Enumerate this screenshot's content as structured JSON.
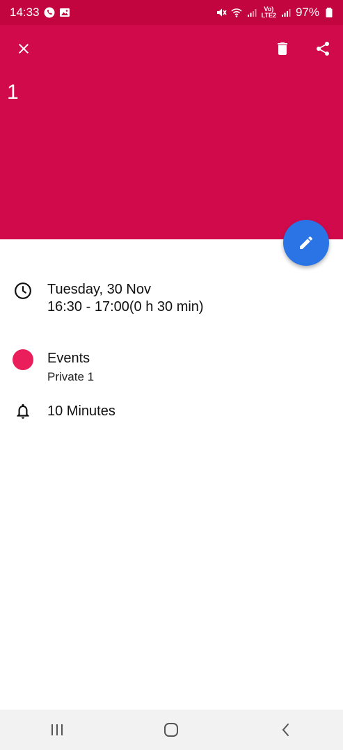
{
  "status_bar": {
    "time": "14:33",
    "battery": "97%",
    "network_label_top": "Vo)",
    "network_label_bottom": "LTE2"
  },
  "header": {
    "title": "1",
    "background_color": "#d10b4b",
    "icons": [
      "close-icon",
      "delete-icon",
      "share-icon"
    ]
  },
  "fab": {
    "icon": "edit-icon",
    "color": "#2a74e6"
  },
  "event": {
    "date": "Tuesday, 30 Nov",
    "time_range": "16:30 - 17:00(0 h 30 min)",
    "calendar_name": "Events",
    "calendar_account": "Private 1",
    "calendar_color": "#e91e5a",
    "reminder": "10 Minutes"
  },
  "nav_bar": {
    "icons": [
      "recent-apps-icon",
      "home-icon",
      "back-icon"
    ]
  }
}
